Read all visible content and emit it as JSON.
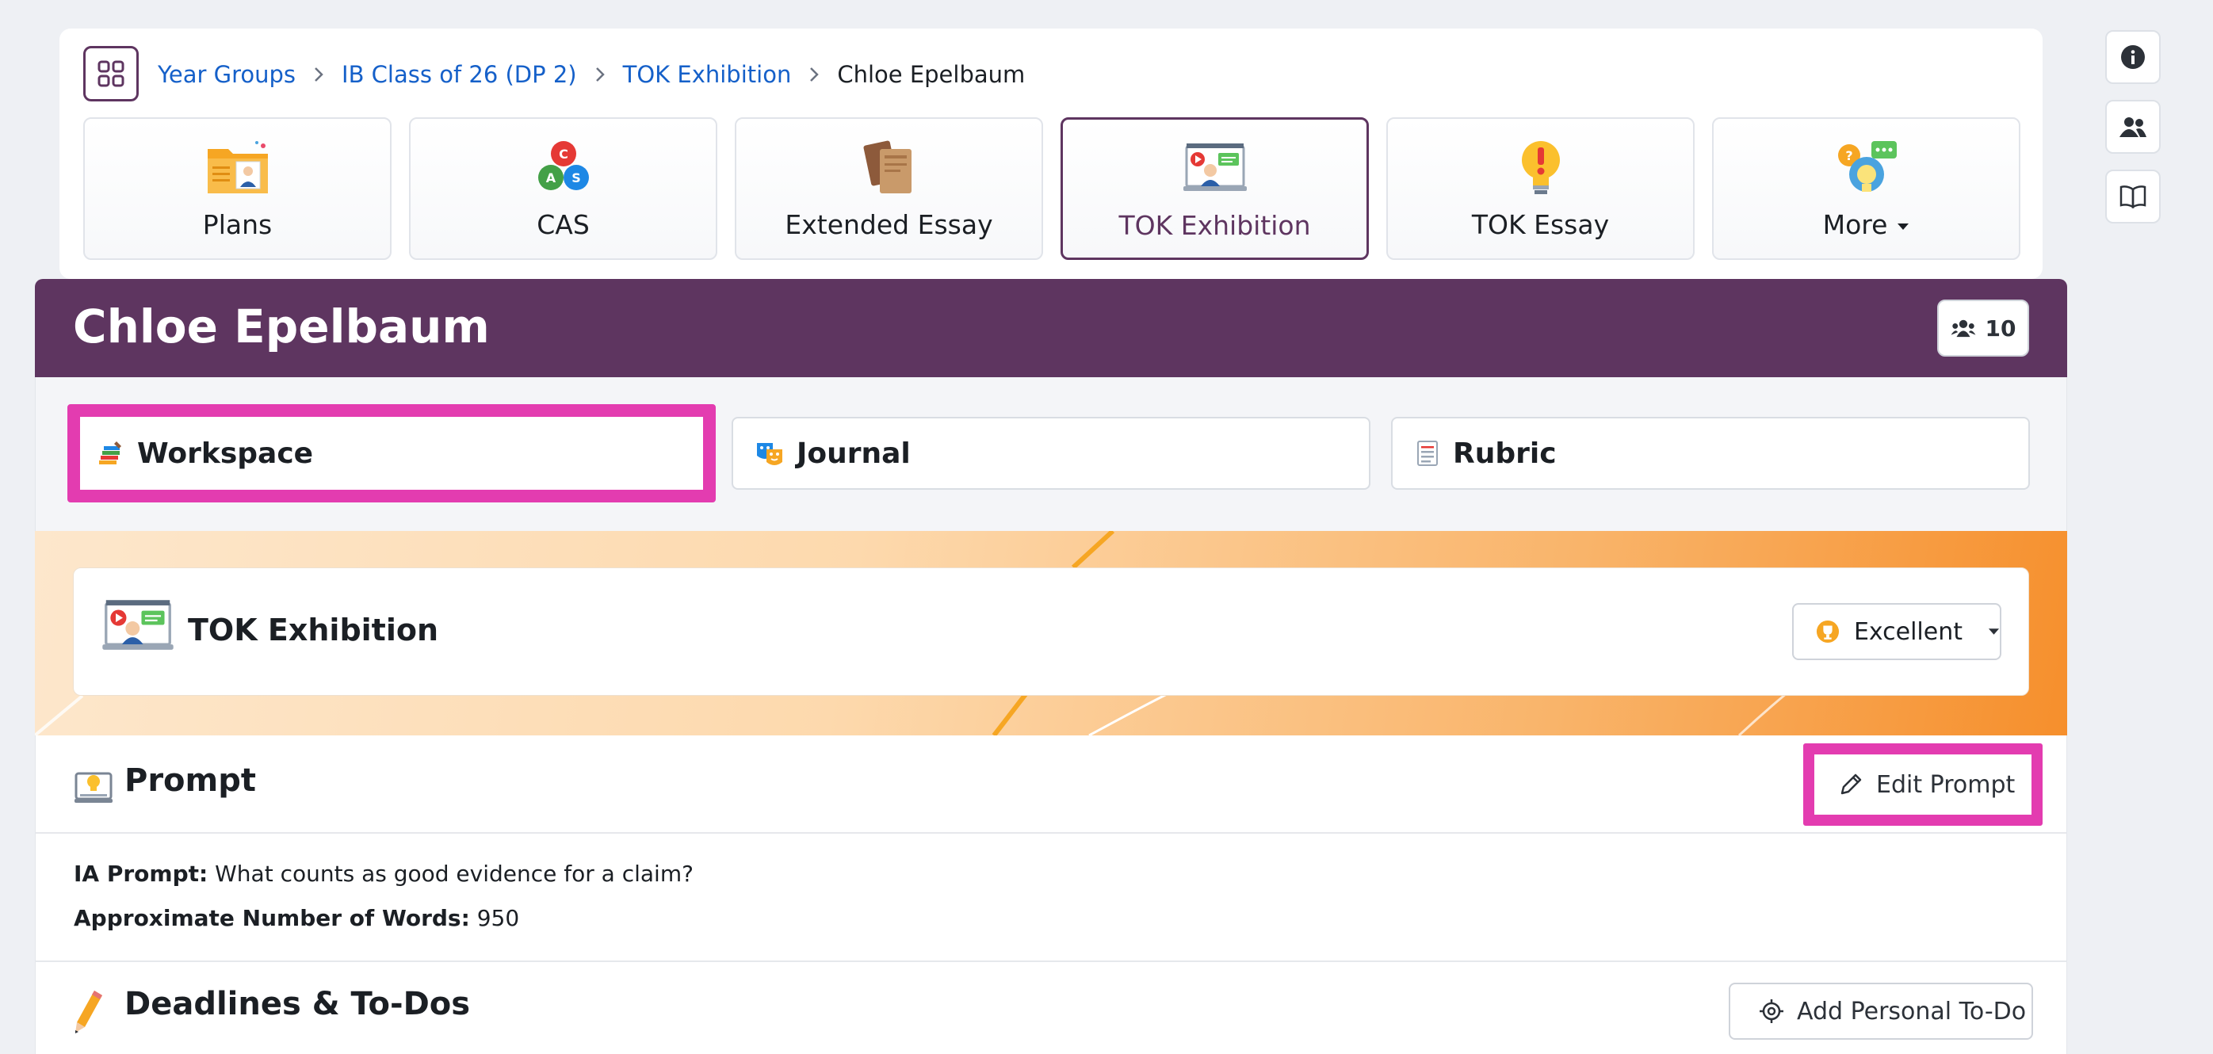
{
  "breadcrumb": {
    "items": [
      "Year Groups",
      "IB Class of 26 (DP 2)",
      "TOK Exhibition"
    ],
    "current": "Chloe Epelbaum"
  },
  "tiles": [
    {
      "label": "Plans",
      "icon": "folder-person-icon"
    },
    {
      "label": "CAS",
      "icon": "cas-triangle-icon"
    },
    {
      "label": "Extended Essay",
      "icon": "books-icon"
    },
    {
      "label": "TOK Exhibition",
      "icon": "presentation-icon",
      "active": true
    },
    {
      "label": "TOK Essay",
      "icon": "lightbulb-exclamation-icon"
    },
    {
      "label": "More",
      "icon": "chat-bulbs-icon"
    }
  ],
  "rail": [
    "info-icon",
    "users-icon",
    "book-icon"
  ],
  "student": {
    "name": "Chloe Epelbaum",
    "member_count": "10"
  },
  "subtabs": [
    {
      "label": "Workspace",
      "icon": "workspace-icon"
    },
    {
      "label": "Journal",
      "icon": "journal-icon"
    },
    {
      "label": "Rubric",
      "icon": "rubric-icon"
    }
  ],
  "banner": {
    "title": "TOK Exhibition",
    "grade": "Excellent"
  },
  "prompt": {
    "title": "Prompt",
    "edit_label": "Edit Prompt",
    "ia_label": "IA Prompt:",
    "ia_value": "What counts as good evidence for a claim?",
    "words_label": "Approximate Number of Words:",
    "words_value": "950"
  },
  "todos": {
    "title": "Deadlines & To-Dos",
    "add_label": "Add Personal To-Do"
  },
  "colors": {
    "brand": "#5e3560",
    "link": "#1560c9",
    "highlight": "#e33cb0",
    "banner_orange": "#f68f2c"
  }
}
